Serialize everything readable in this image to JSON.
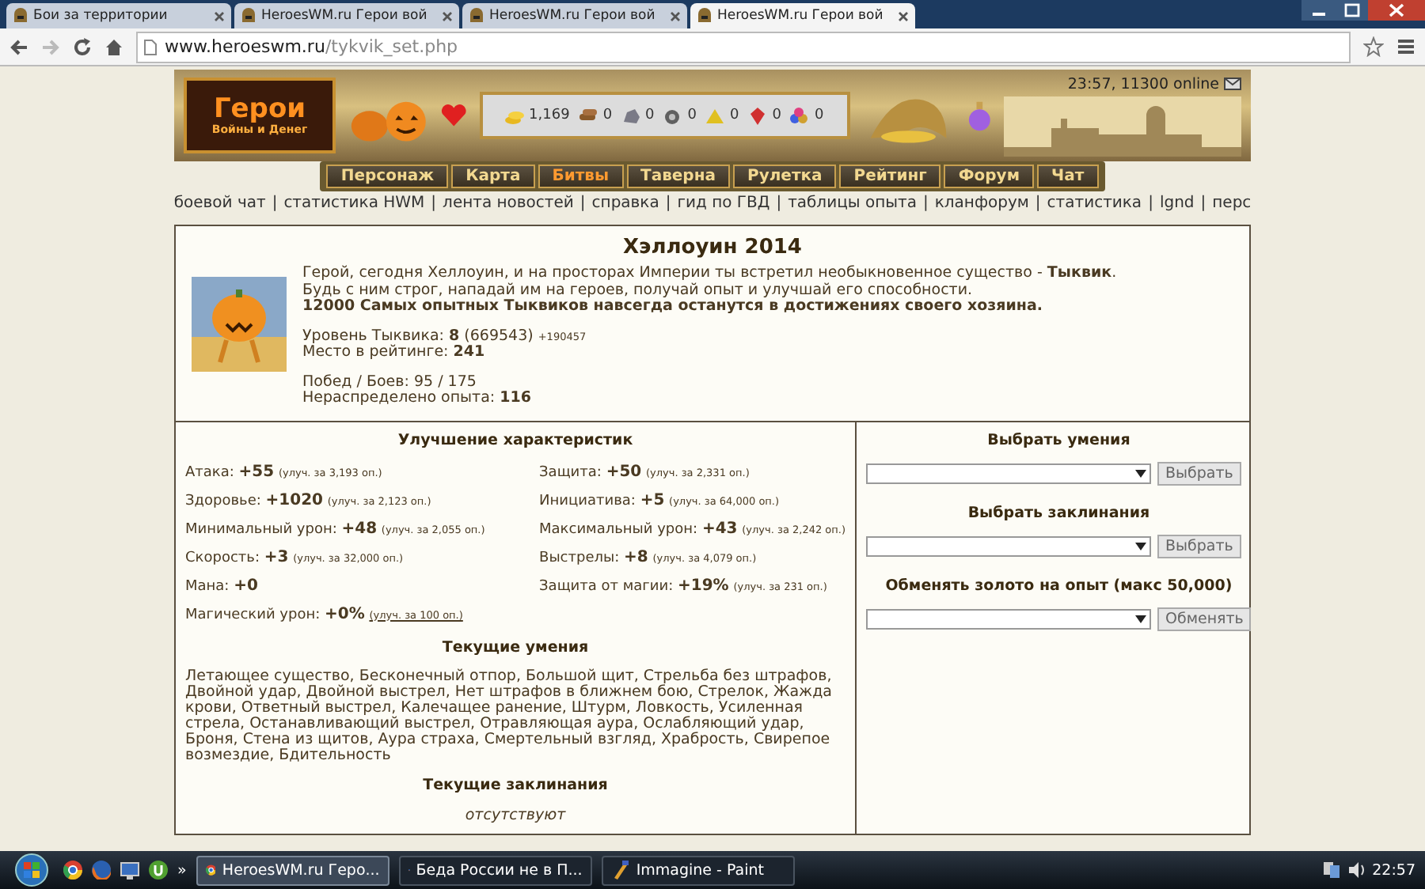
{
  "browser": {
    "tabs": [
      {
        "label": "Бои за территории",
        "selected": false
      },
      {
        "label": "HeroesWM.ru Герои вой",
        "selected": false
      },
      {
        "label": "HeroesWM.ru Герои вой",
        "selected": false
      },
      {
        "label": "HeroesWM.ru Герои вой",
        "selected": true
      }
    ],
    "forward_disabled": true,
    "url_host": "www.heroeswm.ru",
    "url_path": "/tykvik_set.php"
  },
  "header": {
    "logo_title": "Герои",
    "logo_subtitle": "Войны и Денег",
    "resources": [
      {
        "kind": "gold",
        "value": "1,169"
      },
      {
        "kind": "wood",
        "value": "0"
      },
      {
        "kind": "ore",
        "value": "0"
      },
      {
        "kind": "mercury",
        "value": "0"
      },
      {
        "kind": "sulfur",
        "value": "0"
      },
      {
        "kind": "crystal",
        "value": "0"
      },
      {
        "kind": "gems",
        "value": "0"
      }
    ],
    "online": "23:57, 11300 online",
    "nav": [
      {
        "label": "Персонаж",
        "selected": false
      },
      {
        "label": "Карта",
        "selected": false
      },
      {
        "label": "Битвы",
        "selected": true
      },
      {
        "label": "Таверна",
        "selected": false
      },
      {
        "label": "Рулетка",
        "selected": false
      },
      {
        "label": "Рейтинг",
        "selected": false
      },
      {
        "label": "Форум",
        "selected": false
      },
      {
        "label": "Чат",
        "selected": false
      }
    ],
    "links": [
      "боевой чат",
      "статистика HWM",
      "лента новостей",
      "справка",
      "гид по ГВД",
      "таблицы опыта",
      "кланфорум",
      "статистика",
      "lgnd",
      "перс"
    ],
    "link_separator": "|"
  },
  "event": {
    "title": "Хэллоуин 2014",
    "intro": [
      "Герой, сегодня Хеллоуин, и на просторах Империи ты встретил необыкновенное существо - **Тыквик**.",
      "Будь с ним строг, нападай им на героев, получай опыт и улучшай его способности."
    ],
    "intro_bold": "12000 Самых опытных Тыквиков навсегда останутся в достижениях своего хозяина.",
    "level_line": "Уровень Тыквика: **8** (669543)",
    "level_gain": "+190457",
    "rank_line": "Место в рейтинге: **241**",
    "wins_line": "Побед / Боев: 95 / 175",
    "free_exp_line": "Нераспределено опыта: **116**"
  },
  "stats": {
    "title": "Улучшение характеристик",
    "left": [
      {
        "label": "Атака:",
        "value": "+55",
        "cost": "(улуч. за 3,193 оп.)",
        "link": false
      },
      {
        "label": "Здоровье:",
        "value": "+1020",
        "cost": "(улуч. за 2,123 оп.)",
        "link": false
      },
      {
        "label": "Минимальный урон:",
        "value": "+48",
        "cost": "(улуч. за 2,055 оп.)",
        "link": false
      },
      {
        "label": "Скорость:",
        "value": "+3",
        "cost": "(улуч. за 32,000 оп.)",
        "link": false
      },
      {
        "label": "Мана:",
        "value": "+0"
      },
      {
        "label": "Магический урон:",
        "value": "+0%",
        "cost": "(улуч. за 100 оп.)",
        "link": true
      }
    ],
    "right": [
      {
        "label": "Защита:",
        "value": "+50",
        "cost": "(улуч. за 2,331 оп.)",
        "link": false
      },
      {
        "label": "Инициатива:",
        "value": "+5",
        "cost": "(улуч. за 64,000 оп.)",
        "link": false
      },
      {
        "label": "Максимальный урон:",
        "value": "+43",
        "cost": "(улуч. за 2,242 оп.)",
        "link": false
      },
      {
        "label": "Выстрелы:",
        "value": "+8",
        "cost": "(улуч. за 4,079 оп.)",
        "link": false
      },
      {
        "label": "Защита от магии:",
        "value": "+19%",
        "cost": "(улуч. за 231 оп.)",
        "link": false
      }
    ]
  },
  "skills": {
    "title": "Текущие умения",
    "text": "Летающее существо, Бесконечный отпор, Большой щит, Стрельба без штрафов, Двойной удар, Двойной выстрел, Нет штрафов в ближнем бою, Стрелок, Жажда крови, Ответный выстрел, Калечащее ранение, Штурм, Ловкость, Усиленная стрела, Останавливающий выстрел, Отравляющая аура, Ослабляющий удар, Броня, Стена из щитов, Аура страха, Смертельный взгляд, Храбрость, Свирепое возмездие, Бдительность"
  },
  "spells": {
    "title": "Текущие заклинания",
    "text": "отсутствуют"
  },
  "actions": [
    {
      "heading": "Выбрать умения",
      "button": "Выбрать"
    },
    {
      "heading": "Выбрать заклинания",
      "button": "Выбрать"
    },
    {
      "heading": "Обменять золото на опыт (макс 50,000)",
      "button": "Обменять"
    }
  ],
  "taskbar": {
    "more": "»",
    "items": [
      {
        "kind": "chrome",
        "label": "HeroesWM.ru Геро...",
        "selected": true
      },
      {
        "kind": "firefox",
        "label": "Беда России не в П...",
        "selected": false
      },
      {
        "kind": "paint",
        "label": "Immagine - Paint",
        "selected": false
      }
    ],
    "time": "22:57"
  }
}
